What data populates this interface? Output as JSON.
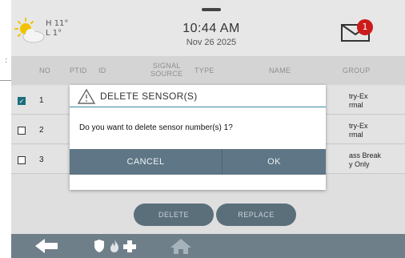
{
  "left_fragment": ":",
  "header": {
    "weather": {
      "high": "H 11°",
      "low": "L 1°",
      "icon": "partly-sunny-icon"
    },
    "time": "10:44 AM",
    "date": "Nov 26 2025",
    "messages_badge": "1"
  },
  "table": {
    "columns": {
      "no": "NO",
      "ptid": "PTID",
      "id": "ID",
      "signal_source_1": "SIGNAL",
      "signal_source_2": "SOURCE",
      "type": "TYPE",
      "name": "NAME",
      "group": "GROUP"
    },
    "rows": [
      {
        "no": "1",
        "checked": true,
        "group_1": "try-Ex",
        "group_2": "rmal"
      },
      {
        "no": "2",
        "checked": false,
        "group_1": "try-Ex",
        "group_2": "rmal"
      },
      {
        "no": "3",
        "checked": false,
        "group_1": "ass Break",
        "group_2": "y Only"
      }
    ]
  },
  "buttons": {
    "delete": "DELETE",
    "replace": "REPLACE"
  },
  "modal": {
    "title": "DELETE SENSOR(S)",
    "message": "Do you want to delete sensor number(s) 1?",
    "cancel": "CANCEL",
    "ok": "OK"
  },
  "footer": {
    "icons": [
      "back-arrow-icon",
      "police-shield-icon",
      "fire-icon",
      "medical-cross-icon",
      "home-icon"
    ]
  },
  "colors": {
    "accent": "#3c87a4",
    "badge": "#cc1b1b",
    "dialog_bar": "#5e7685",
    "footer": "#6f7f8a"
  }
}
